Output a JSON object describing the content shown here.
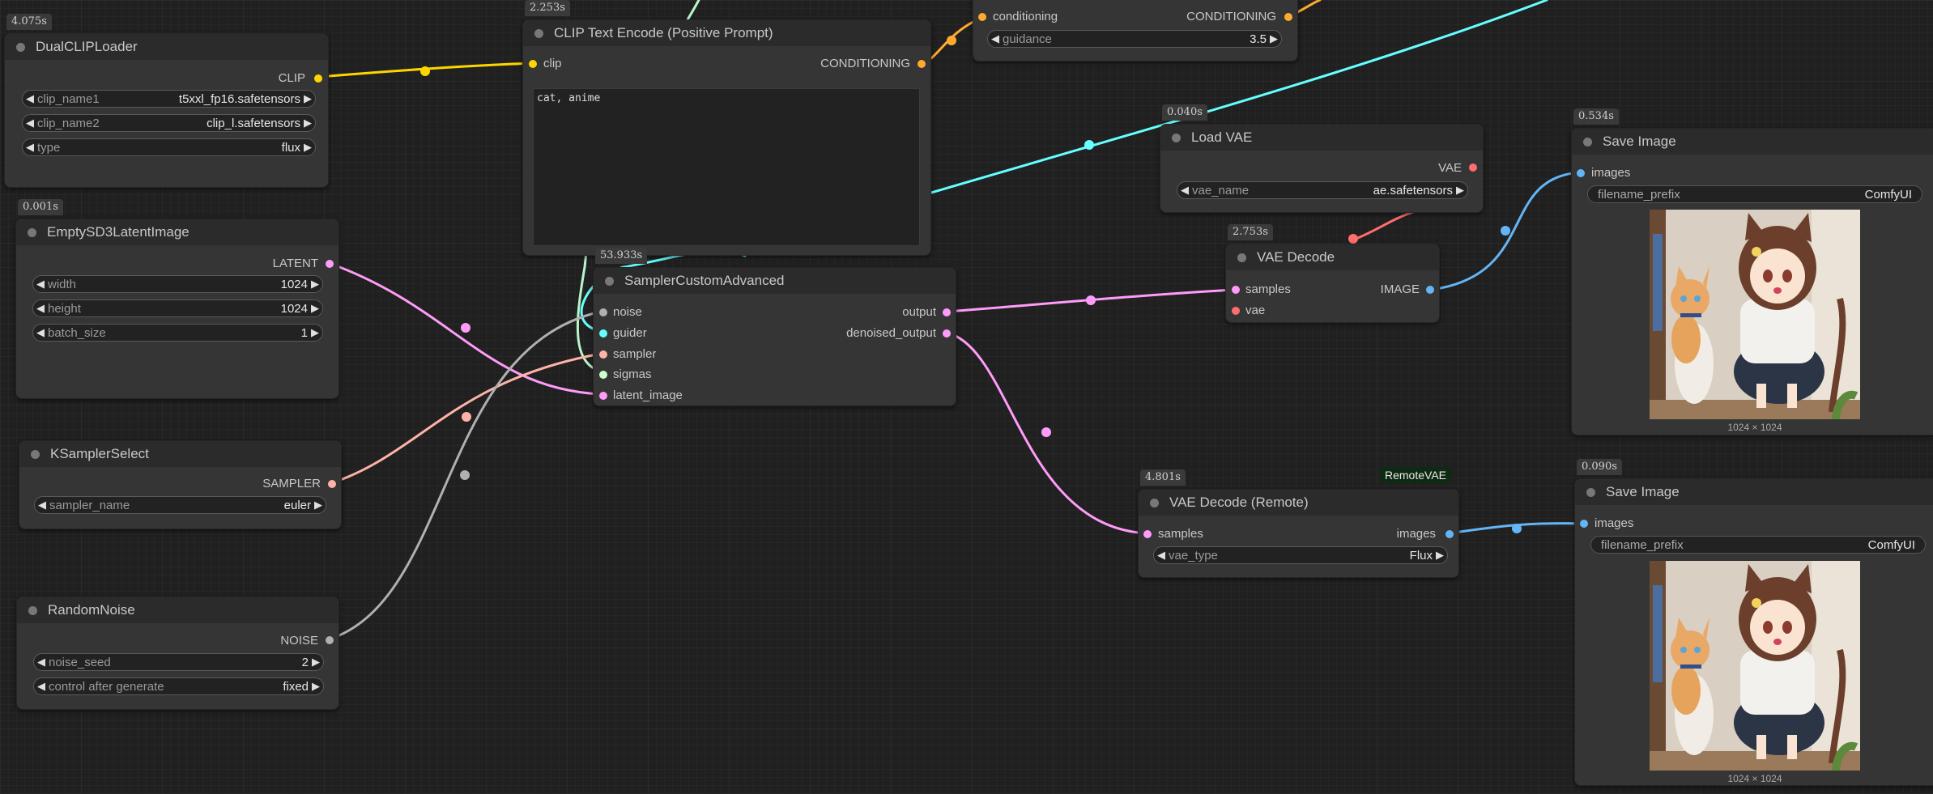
{
  "nodes": {
    "dual_clip_loader": {
      "time": "4.075s",
      "title": "DualCLIPLoader",
      "out_label": "CLIP",
      "widgets": [
        {
          "name": "clip_name1",
          "value": "t5xxl_fp16.safetensors"
        },
        {
          "name": "clip_name2",
          "value": "clip_l.safetensors"
        },
        {
          "name": "type",
          "value": "flux"
        }
      ]
    },
    "empty_latent": {
      "time": "0.001s",
      "title": "EmptySD3LatentImage",
      "out_label": "LATENT",
      "widgets": [
        {
          "name": "width",
          "value": "1024"
        },
        {
          "name": "height",
          "value": "1024"
        },
        {
          "name": "batch_size",
          "value": "1"
        }
      ]
    },
    "ksampler_select": {
      "time": "",
      "title": "KSamplerSelect",
      "out_label": "SAMPLER",
      "widgets": [
        {
          "name": "sampler_name",
          "value": "euler"
        }
      ]
    },
    "random_noise": {
      "time": "",
      "title": "RandomNoise",
      "out_label": "NOISE",
      "widgets": [
        {
          "name": "noise_seed",
          "value": "2"
        },
        {
          "name": "control after generate",
          "value": "fixed"
        }
      ]
    },
    "clip_text_encode": {
      "time": "2.253s",
      "title": "CLIP Text Encode (Positive Prompt)",
      "in_label": "clip",
      "out_label": "CONDITIONING",
      "prompt": "cat, anime"
    },
    "flux_guidance": {
      "in_label": "conditioning",
      "out_label": "CONDITIONING",
      "widgets": [
        {
          "name": "guidance",
          "value": "3.5"
        }
      ]
    },
    "sampler_custom_advanced": {
      "time": "53.933s",
      "title": "SamplerCustomAdvanced",
      "inputs": [
        "noise",
        "guider",
        "sampler",
        "sigmas",
        "latent_image"
      ],
      "outputs": [
        "output",
        "denoised_output"
      ]
    },
    "load_vae": {
      "time": "0.040s",
      "title": "Load VAE",
      "out_label": "VAE",
      "widgets": [
        {
          "name": "vae_name",
          "value": "ae.safetensors"
        }
      ]
    },
    "vae_decode": {
      "time": "2.753s",
      "title": "VAE Decode",
      "inputs": [
        "samples",
        "vae"
      ],
      "out_label": "IMAGE"
    },
    "vae_decode_remote": {
      "time": "4.801s",
      "badge": "RemoteVAE",
      "title": "VAE Decode (Remote)",
      "in_label": "samples",
      "out_label": "images",
      "widgets": [
        {
          "name": "vae_type",
          "value": "Flux"
        }
      ]
    },
    "save_image_1": {
      "time": "0.534s",
      "title": "Save Image",
      "in_label": "images",
      "prefix_label": "filename_prefix",
      "prefix_value": "ComfyUI",
      "caption": "1024 × 1024"
    },
    "save_image_2": {
      "time": "0.090s",
      "title": "Save Image",
      "in_label": "images",
      "prefix_label": "filename_prefix",
      "prefix_value": "ComfyUI",
      "caption": "1024 × 1024"
    }
  },
  "colors": {
    "clip": "#ffd500",
    "conditioning": "#ffa931",
    "latent": "#ff9cf9",
    "sampler": "#ffb3a8",
    "noise": "#b0b0b0",
    "guider": "#66ffff",
    "sigmas": "#cdffcd",
    "vae": "#ff6e6e",
    "image": "#64b5f6"
  }
}
